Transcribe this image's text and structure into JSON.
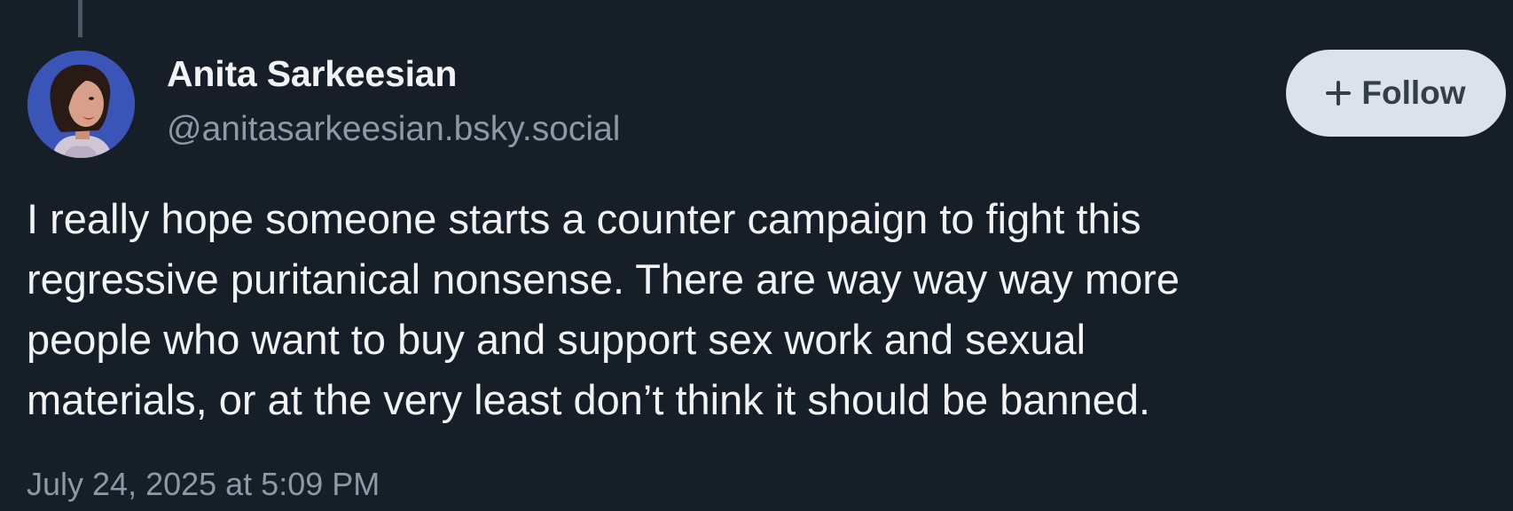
{
  "post": {
    "author": {
      "display_name": "Anita Sarkeesian",
      "handle": "@anitasarkeesian.bsky.social"
    },
    "follow_button": {
      "icon": "plus-icon",
      "label": "Follow"
    },
    "text_lines": [
      "I really hope someone starts a counter campaign to fight this",
      "regressive puritanical nonsense. There are way way way more",
      "people who want to buy and support sex work and sexual",
      "materials, or at the very least don’t think it should be banned."
    ],
    "timestamp": "July 24, 2025 at 5:09 PM"
  },
  "theme": {
    "background": "#161e27",
    "text_primary": "#f1f3f5",
    "text_secondary": "#8c99a6",
    "follow_button_bg": "#dce2ea",
    "avatar_bg": "#3a54b8"
  }
}
